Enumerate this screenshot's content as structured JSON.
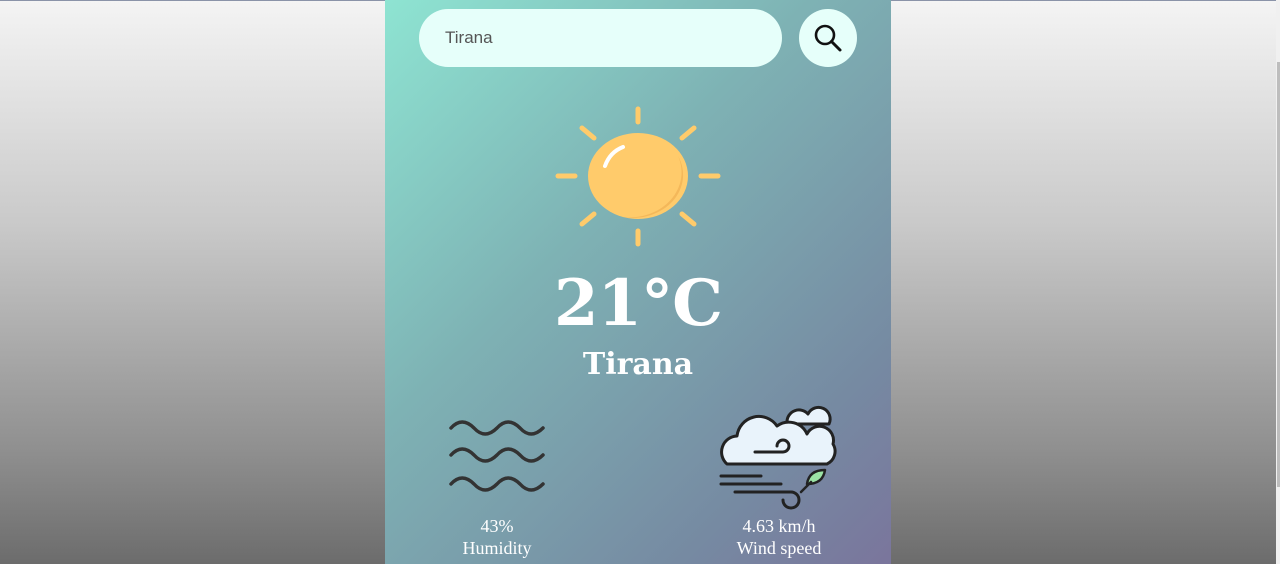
{
  "search": {
    "value": "Tirana",
    "icon": "search-icon"
  },
  "weather": {
    "icon": "sun-icon",
    "temperature": "21°C",
    "city": "Tirana"
  },
  "humidity": {
    "icon": "waves-icon",
    "value": "43%",
    "label": "Humidity"
  },
  "wind": {
    "icon": "wind-icon",
    "value": "4.63 km/h",
    "label": "Wind speed"
  },
  "colors": {
    "sun": "#ffcb6b",
    "input_background": "#e6fffa",
    "card_gradient_start": "#8ee4d2",
    "card_gradient_end": "#7a759c",
    "text": "#ffffff"
  }
}
